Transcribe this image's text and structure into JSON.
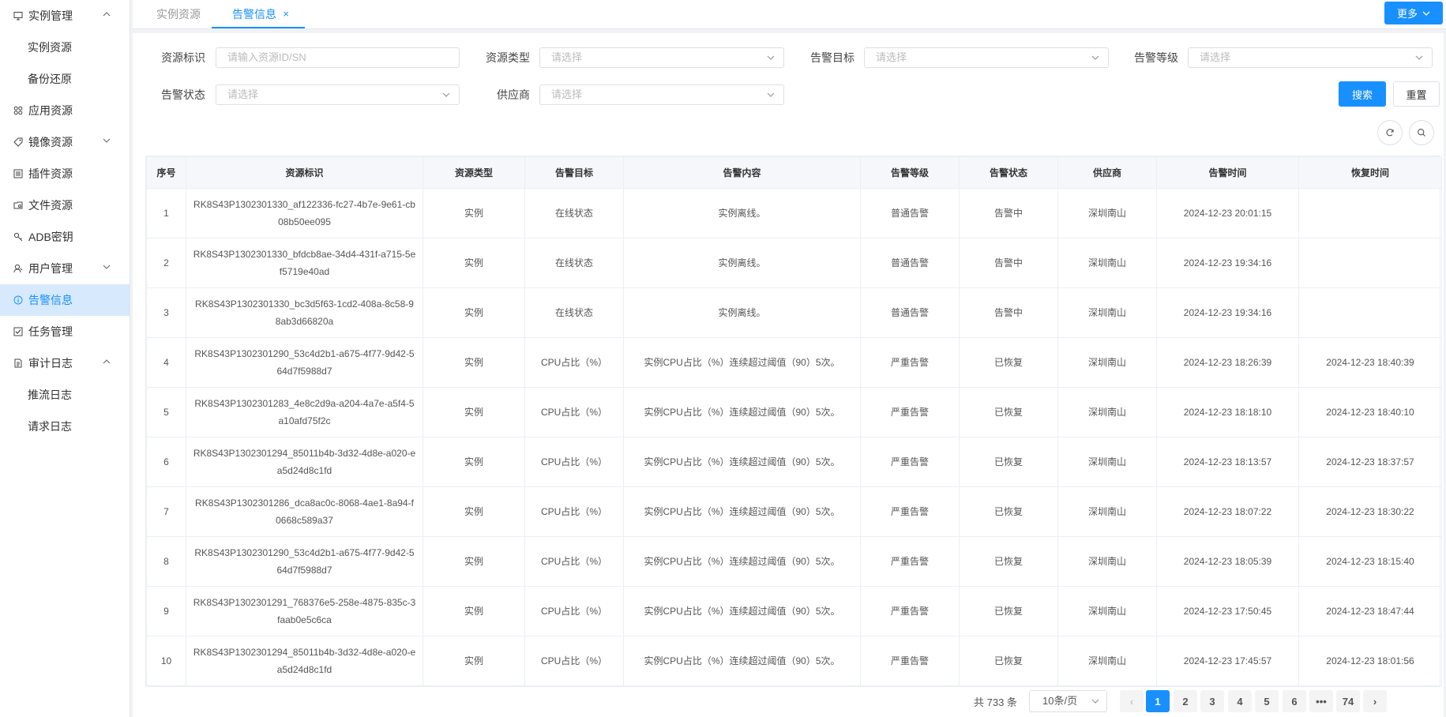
{
  "sidebar": {
    "items": [
      {
        "label": "实例管理",
        "icon": "monitor-icon",
        "arrow": "up"
      },
      {
        "label": "实例资源",
        "sub": true
      },
      {
        "label": "备份还原",
        "sub": true
      },
      {
        "label": "应用资源",
        "icon": "apps-icon"
      },
      {
        "label": "镜像资源",
        "icon": "tag-icon",
        "arrow": "down"
      },
      {
        "label": "插件资源",
        "icon": "list-icon"
      },
      {
        "label": "文件资源",
        "icon": "folder-icon"
      },
      {
        "label": "ADB密钥",
        "icon": "key-icon"
      },
      {
        "label": "用户管理",
        "icon": "user-icon",
        "arrow": "down"
      },
      {
        "label": "告警信息",
        "icon": "info-icon",
        "active": true
      },
      {
        "label": "任务管理",
        "icon": "checkbox-icon"
      },
      {
        "label": "审计日志",
        "icon": "document-icon",
        "arrow": "up"
      },
      {
        "label": "推流日志",
        "sub": true
      },
      {
        "label": "请求日志",
        "sub": true
      }
    ]
  },
  "tabs": [
    {
      "label": "实例资源"
    },
    {
      "label": "告警信息",
      "close": "×"
    }
  ],
  "more_label": "更多",
  "filters": {
    "resource_id": {
      "label": "资源标识",
      "placeholder": "请输入资源ID/SN"
    },
    "resource_type": {
      "label": "资源类型",
      "placeholder": "请选择"
    },
    "alarm_target": {
      "label": "告警目标",
      "placeholder": "请选择"
    },
    "alarm_level": {
      "label": "告警等级",
      "placeholder": "请选择"
    },
    "alarm_status": {
      "label": "告警状态",
      "placeholder": "请选择"
    },
    "vendor": {
      "label": "供应商",
      "placeholder": "请选择"
    },
    "search_label": "搜索",
    "reset_label": "重置"
  },
  "table": {
    "columns": [
      "序号",
      "资源标识",
      "资源类型",
      "告警目标",
      "告警内容",
      "告警等级",
      "告警状态",
      "供应商",
      "告警时间",
      "恢复时间"
    ],
    "rows": [
      [
        "1",
        "RK8S43P1302301330_af122336-fc27-4b7e-9e61-cb08b50ee095",
        "实例",
        "在线状态",
        "实例离线。",
        "普通告警",
        "告警中",
        "深圳南山",
        "2024-12-23 20:01:15",
        ""
      ],
      [
        "2",
        "RK8S43P1302301330_bfdcb8ae-34d4-431f-a715-5ef5719e40ad",
        "实例",
        "在线状态",
        "实例离线。",
        "普通告警",
        "告警中",
        "深圳南山",
        "2024-12-23 19:34:16",
        ""
      ],
      [
        "3",
        "RK8S43P1302301330_bc3d5f63-1cd2-408a-8c58-98ab3d66820a",
        "实例",
        "在线状态",
        "实例离线。",
        "普通告警",
        "告警中",
        "深圳南山",
        "2024-12-23 19:34:16",
        ""
      ],
      [
        "4",
        "RK8S43P1302301290_53c4d2b1-a675-4f77-9d42-564d7f5988d7",
        "实例",
        "CPU占比（%）",
        "实例CPU占比（%）连续超过阈值（90）5次。",
        "严重告警",
        "已恢复",
        "深圳南山",
        "2024-12-23 18:26:39",
        "2024-12-23 18:40:39"
      ],
      [
        "5",
        "RK8S43P1302301283_4e8c2d9a-a204-4a7e-a5f4-5a10afd75f2c",
        "实例",
        "CPU占比（%）",
        "实例CPU占比（%）连续超过阈值（90）5次。",
        "严重告警",
        "已恢复",
        "深圳南山",
        "2024-12-23 18:18:10",
        "2024-12-23 18:40:10"
      ],
      [
        "6",
        "RK8S43P1302301294_85011b4b-3d32-4d8e-a020-ea5d24d8c1fd",
        "实例",
        "CPU占比（%）",
        "实例CPU占比（%）连续超过阈值（90）5次。",
        "严重告警",
        "已恢复",
        "深圳南山",
        "2024-12-23 18:13:57",
        "2024-12-23 18:37:57"
      ],
      [
        "7",
        "RK8S43P1302301286_dca8ac0c-8068-4ae1-8a94-f0668c589a37",
        "实例",
        "CPU占比（%）",
        "实例CPU占比（%）连续超过阈值（90）5次。",
        "严重告警",
        "已恢复",
        "深圳南山",
        "2024-12-23 18:07:22",
        "2024-12-23 18:30:22"
      ],
      [
        "8",
        "RK8S43P1302301290_53c4d2b1-a675-4f77-9d42-564d7f5988d7",
        "实例",
        "CPU占比（%）",
        "实例CPU占比（%）连续超过阈值（90）5次。",
        "严重告警",
        "已恢复",
        "深圳南山",
        "2024-12-23 18:05:39",
        "2024-12-23 18:15:40"
      ],
      [
        "9",
        "RK8S43P1302301291_768376e5-258e-4875-835c-3faab0e5c6ca",
        "实例",
        "CPU占比（%）",
        "实例CPU占比（%）连续超过阈值（90）5次。",
        "严重告警",
        "已恢复",
        "深圳南山",
        "2024-12-23 17:50:45",
        "2024-12-23 18:47:44"
      ],
      [
        "10",
        "RK8S43P1302301294_85011b4b-3d32-4d8e-a020-ea5d24d8c1fd",
        "实例",
        "CPU占比（%）",
        "实例CPU占比（%）连续超过阈值（90）5次。",
        "严重告警",
        "已恢复",
        "深圳南山",
        "2024-12-23 17:45:57",
        "2024-12-23 18:01:56"
      ]
    ]
  },
  "pagination": {
    "total_label": "共 733 条",
    "page_size": "10条/页",
    "pages": [
      "1",
      "2",
      "3",
      "4",
      "5",
      "6",
      "•••",
      "74"
    ],
    "current": "1",
    "prev": "‹",
    "next": "›"
  },
  "colors": {
    "accent": "#1890ff",
    "active_bg": "#d7e9fd"
  }
}
